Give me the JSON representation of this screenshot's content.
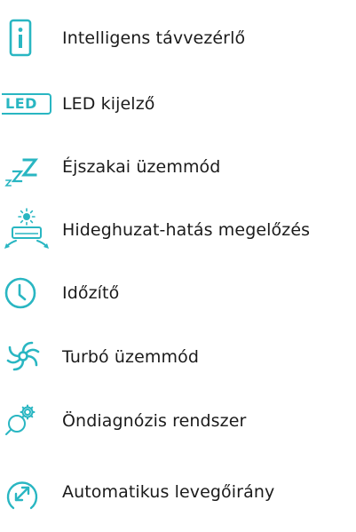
{
  "accent_color": "#29b6c2",
  "text_color": "#1b1b1b",
  "features": [
    {
      "icon": "info-icon",
      "label": "Intelligens távvezérlő"
    },
    {
      "icon": "led-icon",
      "icon_text": "LED",
      "label": "LED kijelző"
    },
    {
      "icon": "sleep-zzz-icon",
      "label": "Éjszakai üzemmód"
    },
    {
      "icon": "air-conditioner-icon",
      "label": "Hideghuzat-hatás megelőzés"
    },
    {
      "icon": "clock-icon",
      "label": "Időzítő"
    },
    {
      "icon": "turbo-icon",
      "label": "Turbó üzemmód"
    },
    {
      "icon": "self-diagnosis-icon",
      "label": "Öndiagnózis rendszer"
    },
    {
      "icon": "auto-airflow-icon",
      "label": "Automatikus levegőirány"
    }
  ]
}
